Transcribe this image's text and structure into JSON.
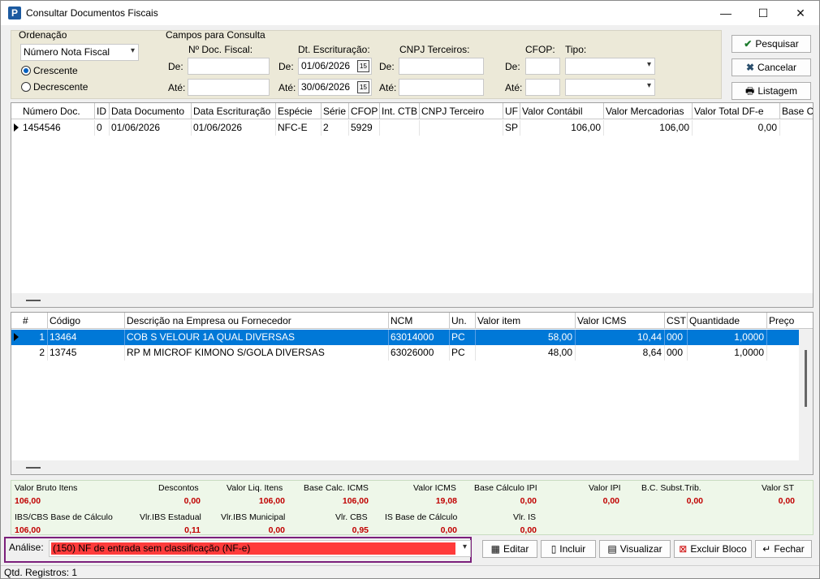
{
  "window": {
    "title": "Consultar Documentos Fiscais",
    "minimize": "—",
    "maximize": "☐",
    "close": "✕"
  },
  "ordenacao": {
    "label": "Ordenação",
    "selected": "Número Nota Fiscal",
    "asc": "Crescente",
    "desc": "Decrescente"
  },
  "campos": {
    "label": "Campos para Consulta",
    "doc_label": "Nº Doc. Fiscal:",
    "dt_label": "Dt. Escrituração:",
    "cnpj_label": "CNPJ Terceiros:",
    "cfop_label": "CFOP:",
    "tipo_label": "Tipo:",
    "de": "De:",
    "ate": "Até:",
    "dt_de": "01/06/2026",
    "dt_ate": "30/06/2026"
  },
  "buttons": {
    "pesquisar": "Pesquisar",
    "cancelar": "Cancelar",
    "listagem": "Listagem",
    "editar": "Editar",
    "incluir": "Incluir",
    "visualizar": "Visualizar",
    "excluir": "Excluir Bloco",
    "fechar": "Fechar"
  },
  "docs": {
    "headers": [
      "Número Doc.",
      "ID",
      "Data Documento",
      "Data Escrituração",
      "Espécie",
      "Série",
      "CFOP",
      "Int. CTB",
      "CNPJ Terceiro",
      "UF",
      "Valor Contábil",
      "Valor Mercadorias",
      "Valor Total DF-e",
      "Base C"
    ],
    "rows": [
      [
        "1454546",
        "0",
        "01/06/2026",
        "01/06/2026",
        "NFC-E",
        "2",
        "5929",
        "",
        "",
        "SP",
        "106,00",
        "106,00",
        "0,00",
        ""
      ]
    ]
  },
  "items": {
    "headers": [
      "#",
      "Código",
      "Descrição na Empresa ou Fornecedor",
      "NCM",
      "Un.",
      "Valor item",
      "Valor ICMS",
      "CST",
      "Quantidade",
      "Preço"
    ],
    "rows": [
      [
        "1",
        "13464",
        "COB S VELOUR 1A QUAL DIVERSAS",
        "63014000",
        "PC",
        "58,00",
        "10,44",
        "000",
        "1,0000",
        ""
      ],
      [
        "2",
        "13745",
        "RP M MICROF KIMONO S/GOLA DIVERSAS",
        "63026000",
        "PC",
        "48,00",
        "8,64",
        "000",
        "1,0000",
        ""
      ]
    ]
  },
  "totals": {
    "l1": [
      "Valor Bruto Itens",
      "Descontos",
      "Valor Liq. Itens",
      "Base Calc. ICMS",
      "Valor ICMS",
      "Base Cálculo IPI",
      "Valor IPI",
      "B.C. Subst.Trib.",
      "Valor ST"
    ],
    "v1": [
      "106,00",
      "0,00",
      "106,00",
      "106,00",
      "19,08",
      "0,00",
      "0,00",
      "0,00",
      "0,00"
    ],
    "l2": [
      "IBS/CBS Base de Cálculo",
      "Vlr.IBS Estadual",
      "Vlr.IBS Municipal",
      "Vlr. CBS",
      "IS Base de Cálculo",
      "Vlr. IS"
    ],
    "v2": [
      "106,00",
      "0,11",
      "0,00",
      "0,95",
      "0,00",
      "0,00"
    ]
  },
  "analise": {
    "label": "Análise:",
    "value": "(150) NF de entrada sem classificação (NF-e)",
    "color": "#ff3b3b"
  },
  "status": {
    "text": "Qtd. Registros: 1"
  }
}
